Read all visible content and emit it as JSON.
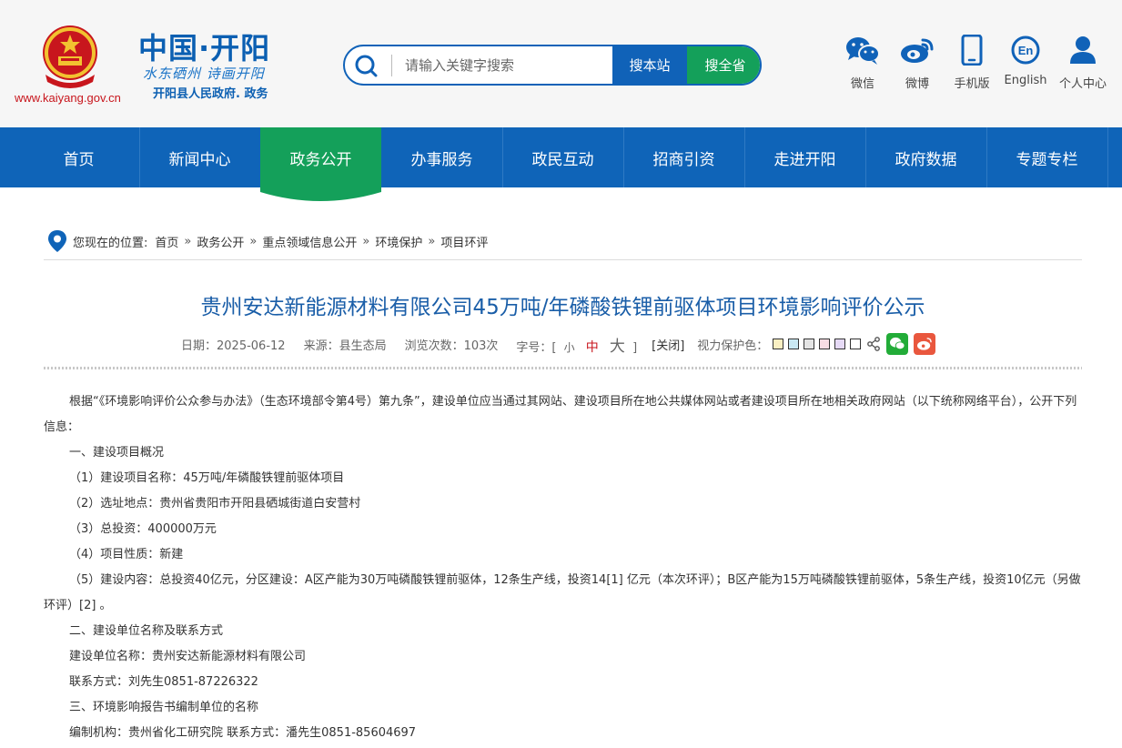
{
  "header": {
    "site_url": "www.kaiyang.gov.cn",
    "brand_title": "中国·开阳",
    "brand_slogan": "水东硒州 诗画开阳",
    "brand_sub": "开阳县人民政府. 政务",
    "search_placeholder": "请输入关键字搜索",
    "search_site_label": "搜本站",
    "search_province_label": "搜全省",
    "quick_links": [
      {
        "label": "微信",
        "icon": "wechat-icon"
      },
      {
        "label": "微博",
        "icon": "weibo-icon"
      },
      {
        "label": "手机版",
        "icon": "mobile-icon"
      },
      {
        "label": "English",
        "icon": "english-icon"
      },
      {
        "label": "个人中心",
        "icon": "user-icon"
      }
    ]
  },
  "nav": {
    "items": [
      "首页",
      "新闻中心",
      "政务公开",
      "办事服务",
      "政民互动",
      "招商引资",
      "走进开阳",
      "政府数据",
      "专题专栏"
    ],
    "active_index": 2
  },
  "breadcrumb": {
    "label": "您现在的位置:",
    "items": [
      "首页",
      "政务公开",
      "重点领域信息公开",
      "环境保护",
      "项目环评"
    ]
  },
  "article": {
    "title": "贵州安达新能源材料有限公司45万吨/年磷酸铁锂前驱体项目环境影响评价公示",
    "meta": {
      "date": "日期：2025-06-12",
      "source": "来源：县生态局",
      "views": "浏览次数：103次",
      "font_size_label": "字号：[",
      "font_small": "小",
      "font_medium": "中",
      "font_large": "大",
      "font_close_bracket": "]",
      "close": "[关闭]",
      "eye_care_label": "视力保护色："
    },
    "swatch_colors": [
      "#f9efc2",
      "#c9e8f3",
      "#e4e4e4",
      "#f8dde4",
      "#e6daf6",
      "#ffffff"
    ],
    "paragraphs": [
      "根据“《环境影响评价公众参与办法》（生态环境部令第4号）第九条”，建设单位应当通过其网站、建设项目所在地公共媒体网站或者建设项目所在地相关政府网站（以下统称网络平台），公开下列信息：",
      "一、建设项目概况",
      "（1）建设项目名称：45万吨/年磷酸铁锂前驱体项目",
      "（2）选址地点：贵州省贵阳市开阳县硒城街道白安营村",
      "（3）总投资：400000万元",
      "（4）项目性质：新建",
      "（5）建设内容：总投资40亿元，分区建设：A区产能为30万吨磷酸铁锂前驱体，12条生产线，投资14[1] 亿元（本次环评）；B区产能为15万吨磷酸铁锂前驱体，5条生产线，投资10亿元（另做环评）[2] 。",
      "二、建设单位名称及联系方式",
      "建设单位名称：贵州安达新能源材料有限公司",
      "联系方式：刘先生0851-87226322",
      "三、环境影响报告书编制单位的名称",
      "编制机构：贵州省化工研究院  联系方式：潘先生0851-85604697"
    ]
  },
  "colors": {
    "primary_blue": "#0f64b8",
    "active_green": "#14a05a",
    "title_blue": "#1a5ea8",
    "emblem_red": "#c8161d",
    "wechat_green": "#22ac38",
    "weibo_red": "#e9573e"
  }
}
